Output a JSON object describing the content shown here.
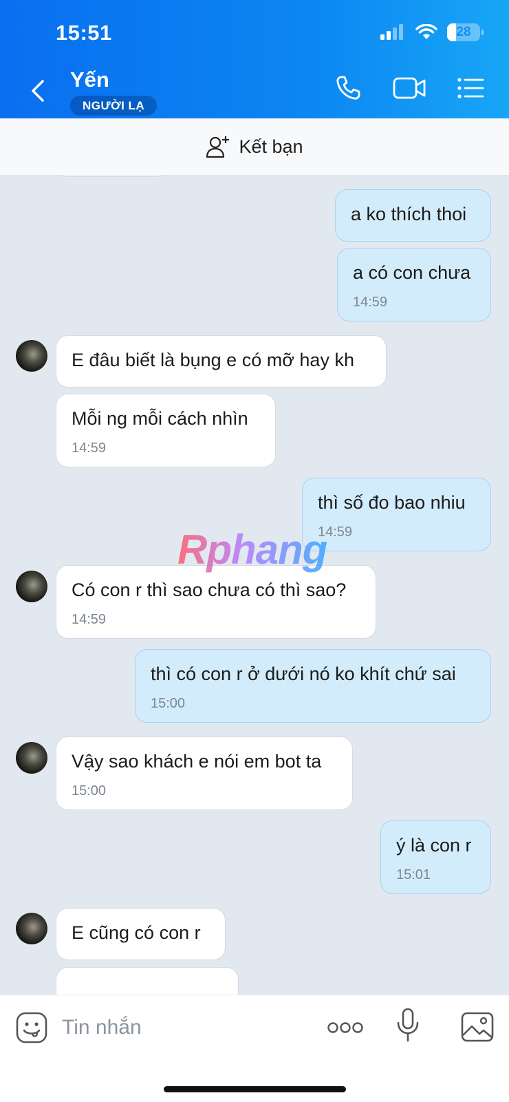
{
  "status_bar": {
    "time": "15:51",
    "battery": "28",
    "battery_level": 0.28
  },
  "header": {
    "contact_name": "Yến",
    "badge": "NGƯỜI LẠ"
  },
  "friend_bar": {
    "label": "Kết bạn"
  },
  "messages": [
    {
      "dir": "out",
      "text": "a ko thích thoi",
      "time": ""
    },
    {
      "dir": "out",
      "text": "a có con chưa",
      "time": "14:59"
    },
    {
      "dir": "in",
      "text": "E đâu biết là bụng e có mỡ hay kh",
      "time": ""
    },
    {
      "dir": "in",
      "text": "Mỗi ng mỗi cách nhìn",
      "time": "14:59"
    },
    {
      "dir": "out",
      "text": "thì số đo bao nhiu",
      "time": "14:59"
    },
    {
      "dir": "in",
      "text": "Có con r thì sao chưa có thì sao?",
      "time": "14:59"
    },
    {
      "dir": "out",
      "text": "thì  có con r ở dưới nó ko khít chứ sai",
      "time": "15:00"
    },
    {
      "dir": "in",
      "text": "Vậy sao khách e nói em bot ta",
      "time": "15:00"
    },
    {
      "dir": "out",
      "text": "ý là con r",
      "time": "15:01"
    },
    {
      "dir": "in",
      "text": "E cũng có con r",
      "time": ""
    }
  ],
  "watermark": "Rphang",
  "composer": {
    "placeholder": "Tin nhắn"
  },
  "colors": {
    "header_start": "#0a6ff0",
    "header_end": "#18a6f6",
    "incoming_bubble": "#ffffff",
    "outgoing_bubble": "#d3ecfb",
    "chat_bg": "#e2e8f0"
  }
}
